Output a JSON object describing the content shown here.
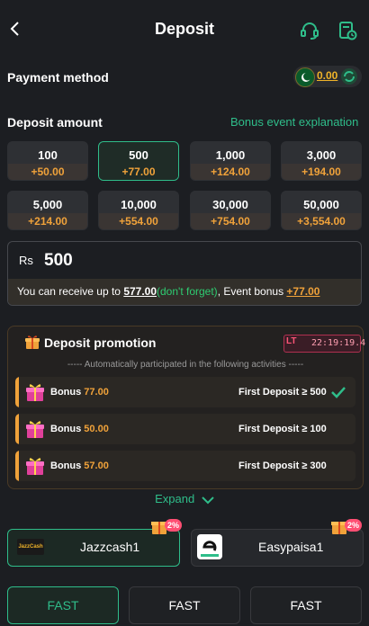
{
  "header": {
    "title": "Deposit"
  },
  "payment": {
    "label": "Payment method",
    "balance": "0.00"
  },
  "deposit": {
    "label": "Deposit amount",
    "bonus_link": "Bonus event explanation",
    "amounts": [
      {
        "amount": "100",
        "bonus": "+50.00"
      },
      {
        "amount": "500",
        "bonus": "+77.00"
      },
      {
        "amount": "1,000",
        "bonus": "+124.00"
      },
      {
        "amount": "3,000",
        "bonus": "+194.00"
      },
      {
        "amount": "5,000",
        "bonus": "+214.00"
      },
      {
        "amount": "10,000",
        "bonus": "+554.00"
      },
      {
        "amount": "30,000",
        "bonus": "+754.00"
      },
      {
        "amount": "50,000",
        "bonus": "+3,554.00"
      }
    ],
    "selected_index": 1
  },
  "input": {
    "currency": "Rs",
    "value": "500",
    "receive_prefix": "You can receive up to ",
    "receive_amount": "577.00",
    "receive_note": "(don't forget)",
    "event_prefix": ", Event bonus ",
    "event_bonus": "+77.00"
  },
  "promotion": {
    "title": "Deposit promotion",
    "badge": "LT",
    "timer": "22:19:19.4",
    "subtitle": "----- Automatically participated in the following activities -----",
    "rows": [
      {
        "bonus_label": "Bonus",
        "bonus_value": "77.00",
        "condition": "First Deposit ≥ 500",
        "checked": true
      },
      {
        "bonus_label": "Bonus",
        "bonus_value": "50.00",
        "condition": "First Deposit ≥ 100",
        "checked": false
      },
      {
        "bonus_label": "Bonus",
        "bonus_value": "57.00",
        "condition": "First Deposit ≥ 300",
        "checked": false
      }
    ]
  },
  "expand": {
    "label": "Expand"
  },
  "methods": [
    {
      "name": "Jazzcash1",
      "logo_text": "JazzCash",
      "badge": "2%"
    },
    {
      "name": "Easypaisa1",
      "badge": "2%"
    }
  ],
  "channels": [
    "FAST",
    "FAST",
    "FAST"
  ],
  "colors": {
    "accent": "#2fbd8a",
    "bonus": "#f0a23a",
    "background": "#1c1e22"
  }
}
